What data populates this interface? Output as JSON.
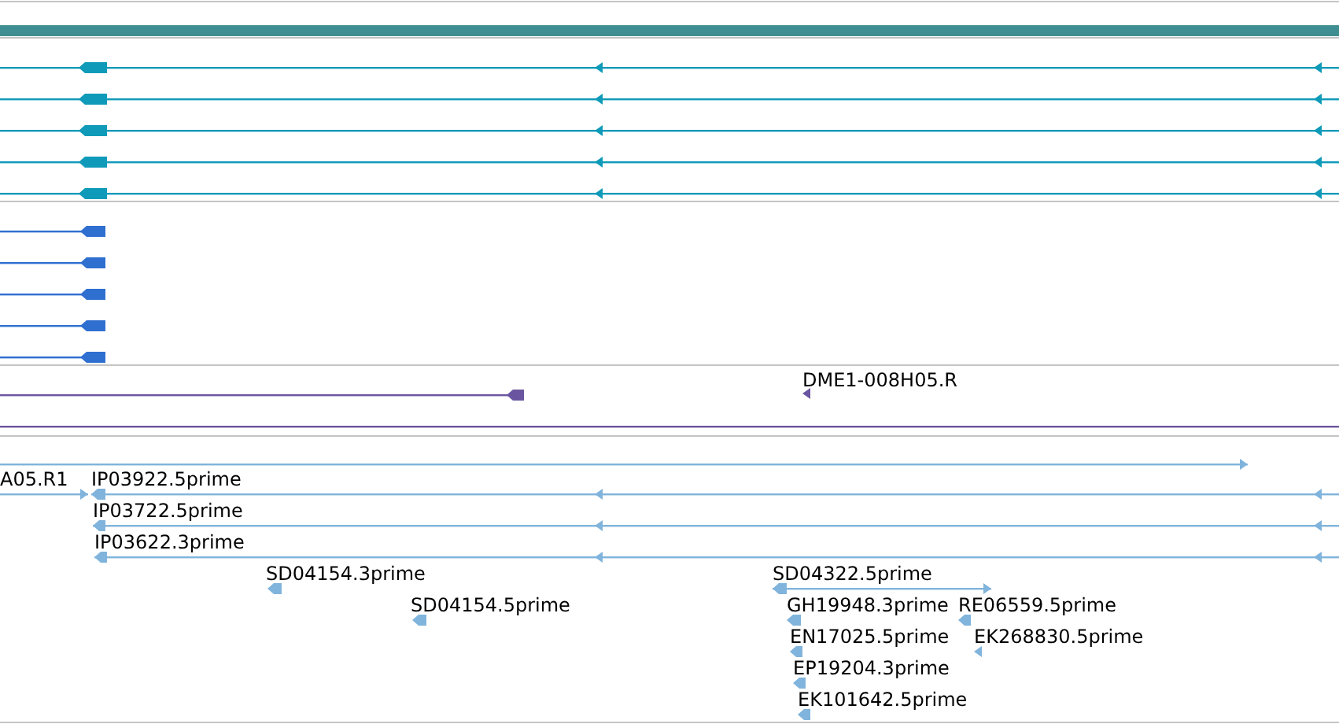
{
  "tracks": [
    {
      "kind": "bar",
      "color": "#3f8f92"
    },
    {
      "kind": "features",
      "color": "#0e9ab8",
      "features": [
        {
          "reverse": true
        },
        {
          "reverse": true
        },
        {
          "reverse": true
        },
        {
          "reverse": true
        },
        {
          "reverse": true
        }
      ]
    },
    {
      "kind": "features",
      "color": "#2f6fd0",
      "features": [
        {
          "reverse": true
        },
        {
          "reverse": true
        },
        {
          "reverse": true
        },
        {
          "reverse": true
        },
        {
          "reverse": true
        }
      ]
    },
    {
      "kind": "features",
      "color": "#6a55a0",
      "features": [
        {
          "reverse": true
        },
        {
          "label": "DME1-008H05.R",
          "reverse": true
        }
      ]
    },
    {
      "kind": "features",
      "color": "#80b4dc",
      "features": [
        {
          "reverse": false
        },
        {
          "label": "A05.R1",
          "reverse": false
        },
        {
          "label": "IP03922.5prime",
          "reverse": true
        },
        {
          "label": "IP03722.5prime",
          "reverse": true
        },
        {
          "label": "IP03622.3prime",
          "reverse": true
        },
        {
          "label": "SD04154.3prime",
          "reverse": true
        },
        {
          "label": "SD04154.5prime",
          "reverse": true
        },
        {
          "label": "SD04322.5prime",
          "reverse": true
        },
        {
          "label": "GH19948.3prime",
          "reverse": true
        },
        {
          "label": "RE06559.5prime",
          "reverse": true
        },
        {
          "label": "EN17025.5prime",
          "reverse": true
        },
        {
          "label": "EK268830.5prime",
          "reverse": true
        },
        {
          "label": "EP19204.3prime",
          "reverse": true
        },
        {
          "label": "EK101642.5prime",
          "reverse": true
        }
      ]
    }
  ]
}
